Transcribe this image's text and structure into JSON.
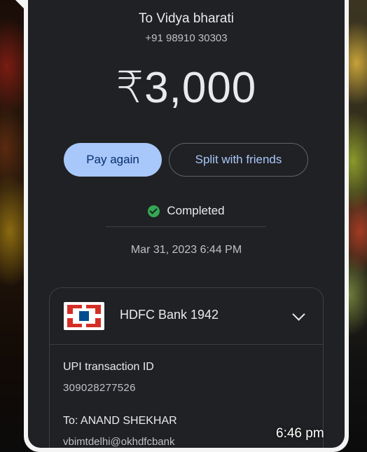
{
  "payment": {
    "recipient": "To Vidya bharati",
    "phone": "+91 98910 30303",
    "amount": "₹3,000",
    "status": "Completed",
    "datetime": "Mar 31, 2023 6:44 PM"
  },
  "actions": {
    "pay_again": "Pay again",
    "split": "Split with friends"
  },
  "details": {
    "bank": "HDFC Bank 1942",
    "upi_label": "UPI transaction ID",
    "upi_id": "309028277526",
    "to_label": "To: ANAND SHEKHAR",
    "vpa": "vbimtdelhi@okhdfcbank"
  },
  "message": {
    "time": "6:46 pm"
  },
  "colors": {
    "screen_bg": "#202124",
    "pay_button": "#a8c7fa",
    "status_green": "#34a853",
    "bank_red": "#d42e27",
    "bank_blue": "#004c8f"
  },
  "icons": [
    "check-circle-icon",
    "hdfc-logo-icon",
    "chevron-down-icon"
  ]
}
